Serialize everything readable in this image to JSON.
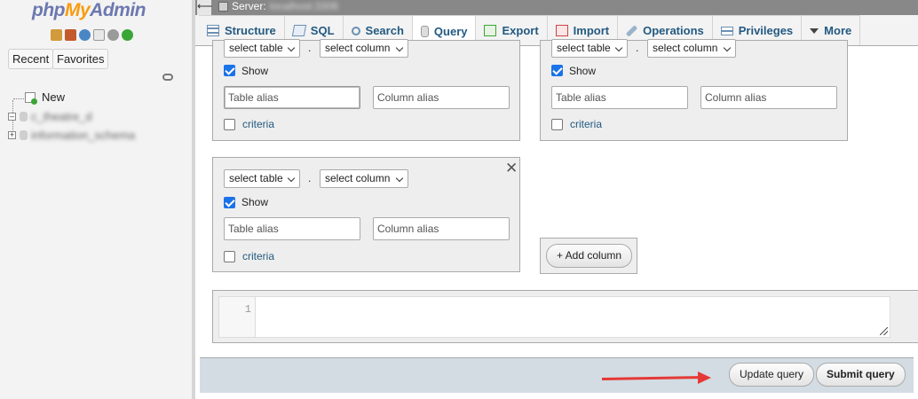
{
  "nav": {
    "logo": {
      "php": "php",
      "my": "My",
      "admin": "Admin"
    },
    "icons": [
      "home-icon",
      "exit-icon",
      "help-icon",
      "docs-icon",
      "settings-icon",
      "reload-icon"
    ],
    "recent_label": "Recent",
    "favorites_label": "Favorites",
    "tree": {
      "new_label": "New",
      "db1_label": "c_theatre_d",
      "db2_label": "information_schema"
    }
  },
  "topbar": {
    "server_label": "Server:",
    "server_name": "localhost:3306"
  },
  "tabs": [
    {
      "label": "Structure",
      "icon": "structure-icon"
    },
    {
      "label": "SQL",
      "icon": "sql-icon"
    },
    {
      "label": "Search",
      "icon": "search-icon"
    },
    {
      "label": "Query",
      "icon": "query-icon"
    },
    {
      "label": "Export",
      "icon": "export-icon"
    },
    {
      "label": "Import",
      "icon": "import-icon"
    },
    {
      "label": "Operations",
      "icon": "operations-icon"
    },
    {
      "label": "Privileges",
      "icon": "privileges-icon"
    },
    {
      "label": "More",
      "icon": "chevron-down-icon"
    }
  ],
  "query": {
    "select_table": "select table",
    "select_column": "select column",
    "dot": ".",
    "show_label": "Show",
    "table_alias_placeholder": "Table alias",
    "column_alias_placeholder": "Column alias",
    "criteria_label": "criteria",
    "add_column_label": "+ Add column",
    "close_symbol": "✕"
  },
  "editor": {
    "line_number": "1",
    "content": ""
  },
  "actions": {
    "update_query": "Update query",
    "submit_query": "Submit query"
  },
  "colors": {
    "link": "#235a81",
    "arrow": "#e53935",
    "checkbox": "#1a73e8"
  }
}
